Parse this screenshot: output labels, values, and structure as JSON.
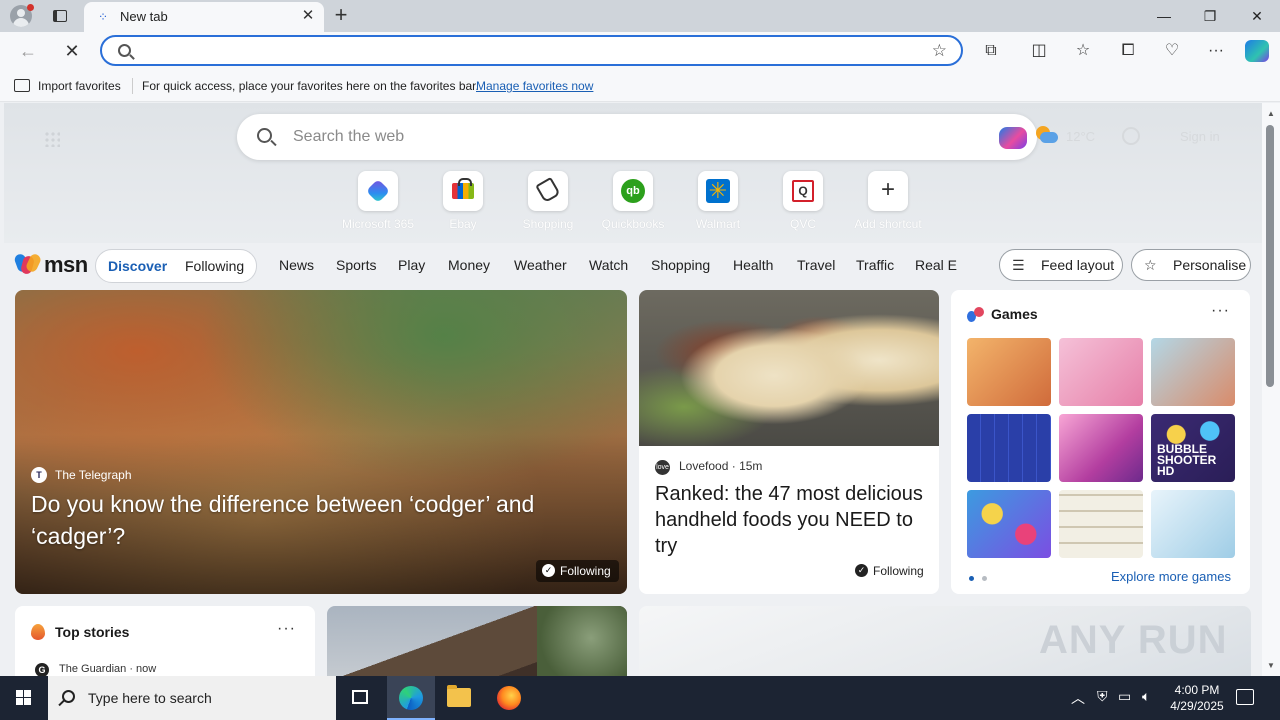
{
  "browser": {
    "tab_title": "New tab",
    "tab_close": "✕",
    "new_tab": "+",
    "window_controls": {
      "minimize": "—",
      "maximize": "❐",
      "close": "✕"
    },
    "nav": {
      "back": "←",
      "stop": "✕"
    },
    "address_placeholder": "",
    "favorite_star": "☆"
  },
  "favorites_bar": {
    "import_label": "Import favorites",
    "message": "For quick access, place your favorites here on the favorites bar.",
    "manage_link": "Manage favorites now"
  },
  "newtab": {
    "search_placeholder": "Search the web",
    "temperature": "12°C",
    "sign_in": "Sign in",
    "shortcuts": [
      {
        "label": "Microsoft 365",
        "icon": "microsoft-365-icon"
      },
      {
        "label": "Ebay",
        "icon": "ebay-icon"
      },
      {
        "label": "Shopping",
        "icon": "shopping-tag-icon"
      },
      {
        "label": "Quickbooks",
        "icon": "quickbooks-icon",
        "glyph": "qb"
      },
      {
        "label": "Walmart",
        "icon": "walmart-icon",
        "glyph": "✳"
      },
      {
        "label": "QVC",
        "icon": "qvc-icon",
        "glyph": "Q"
      },
      {
        "label": "Add shortcut",
        "icon": "plus-icon",
        "glyph": "+"
      }
    ]
  },
  "msn": {
    "logo": "msn",
    "pill": {
      "discover": "Discover",
      "following": "Following"
    },
    "nav_items": [
      "News",
      "Sports",
      "Play",
      "Money",
      "Weather",
      "Watch",
      "Shopping",
      "Health",
      "Travel",
      "Traffic",
      "Real E"
    ],
    "feed_layout": "Feed layout",
    "personalise": "Personalise"
  },
  "hero": {
    "source": "The Telegraph",
    "title": "Do you know the difference between ‘codger’ and ‘cadger’?",
    "following": "Following"
  },
  "food": {
    "source": "Lovefood",
    "age": "15m",
    "title": "Ranked: the 47 most delicious handheld foods you NEED to try",
    "following": "Following"
  },
  "games": {
    "title": "Games",
    "more": "···",
    "explore": "Explore more games",
    "bubble_label": "BUBBLE SHOOTER HD"
  },
  "top_stories": {
    "title": "Top stories",
    "more": "···",
    "source": "The Guardian · now"
  },
  "watermark": "ANY RUN",
  "taskbar": {
    "search_placeholder": "Type here to search",
    "time": "4:00 PM",
    "date": "4/29/2025"
  }
}
